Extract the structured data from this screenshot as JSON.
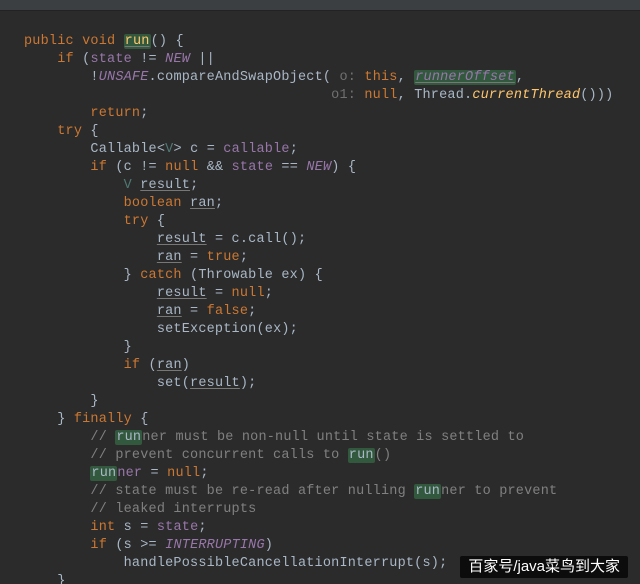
{
  "tok": {
    "public": "public",
    "void": "void",
    "run": "run",
    "if": "if",
    "state": "state",
    "NEW": "NEW",
    "UNSAFE": "UNSAFE",
    "cas": "compareAndSwapObject",
    "ohint": "o: ",
    "this": "this",
    "runnerOffset": "runnerOffset",
    "o1hint": "o1: ",
    "null": "null",
    "Thread": "Thread",
    "currentThread": "currentThread",
    "return": "return",
    "try": "try",
    "Callable": "Callable",
    "V": "V",
    "c": "c",
    "callable": "callable",
    "result": "result",
    "boolean": "boolean",
    "ran": "ran",
    "call": "call",
    "true": "true",
    "catch": "catch",
    "Throwable": "Throwable",
    "ex": "ex",
    "false": "false",
    "setException": "setException",
    "set": "set",
    "finally": "finally",
    "cm1": "ner must be non-null until state is settled to",
    "cm2": "// prevent concurrent calls to ",
    "runnerVar": "ner",
    "cm3": "// state must be re-read after nulling ",
    "cm3b": "ner to prevent",
    "cm4": "// leaked interrupts",
    "int": "int",
    "s": "s",
    "INTERRUPTING": "INTERRUPTING",
    "hpc": "handlePossibleCancellationInterrupt"
  },
  "watermark": "百家号/java菜鸟到大家"
}
